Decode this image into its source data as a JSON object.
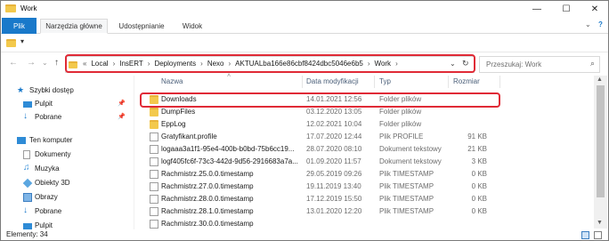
{
  "window": {
    "title": "Work",
    "minimize": "—",
    "maximize": "☐",
    "close": "✕"
  },
  "ribbon": {
    "tabs": [
      "Plik",
      "Narzędzia główne",
      "Udostępnianie",
      "Widok"
    ],
    "active_tab": "Narzędzia główne",
    "toggle": "⌄",
    "help": "?"
  },
  "qat": {
    "dropdown": "▾"
  },
  "address": {
    "back": "←",
    "forward": "→",
    "recent": "⌄",
    "up": "↑",
    "overflow": "«",
    "crumbs": [
      "Local",
      "InsERT",
      "Deployments",
      "Nexo",
      "AKTUALba166e86cbf8424dbc5046e6b5",
      "Work"
    ],
    "separator": "›",
    "dropdown": "⌄",
    "refresh": "↻"
  },
  "search": {
    "placeholder": "Przeszukaj: Work",
    "icon": "⌕"
  },
  "nav": {
    "items": [
      {
        "label": "Szybki dostęp",
        "icon": "star-icon",
        "pinned": false
      },
      {
        "label": "Pulpit",
        "icon": "desktop-icon",
        "pinned": true
      },
      {
        "label": "Pobrane",
        "icon": "download-icon",
        "pinned": true
      },
      {
        "label": "Ten komputer",
        "icon": "computer-icon",
        "pinned": false
      },
      {
        "label": "Dokumenty",
        "icon": "documents-icon",
        "pinned": false
      },
      {
        "label": "Muzyka",
        "icon": "music-icon",
        "pinned": false
      },
      {
        "label": "Obiekty 3D",
        "icon": "cube-icon",
        "pinned": false
      },
      {
        "label": "Obrazy",
        "icon": "pictures-icon",
        "pinned": false
      },
      {
        "label": "Pobrane",
        "icon": "download-icon",
        "pinned": false
      },
      {
        "label": "Pulpit",
        "icon": "desktop-icon",
        "pinned": false
      }
    ]
  },
  "columns": {
    "name": "Nazwa",
    "modified": "Data modyfikacji",
    "type": "Typ",
    "size": "Rozmiar",
    "sort_arrow": "˄"
  },
  "files": [
    {
      "name": "Downloads",
      "modified": "14.01.2021 12:56",
      "type": "Folder plików",
      "size": "",
      "kind": "folder"
    },
    {
      "name": "DumpFiles",
      "modified": "03.12.2020 13:05",
      "type": "Folder plików",
      "size": "",
      "kind": "folder"
    },
    {
      "name": "EppLog",
      "modified": "12.02.2021 10:04",
      "type": "Folder plików",
      "size": "",
      "kind": "folder"
    },
    {
      "name": "Gratyfikant.profile",
      "modified": "17.07.2020 12:44",
      "type": "Plik PROFILE",
      "size": "91 KB",
      "kind": "file"
    },
    {
      "name": "logaaa3a1f1-95e4-400b-b0bd-75b6cc19...",
      "modified": "28.07.2020 08:10",
      "type": "Dokument tekstowy",
      "size": "21 KB",
      "kind": "file"
    },
    {
      "name": "logf405fc6f-73c3-442d-9d56-2916683a7a...",
      "modified": "01.09.2020 11:57",
      "type": "Dokument tekstowy",
      "size": "3 KB",
      "kind": "file"
    },
    {
      "name": "Rachmistrz.25.0.0.timestamp",
      "modified": "29.05.2019 09:26",
      "type": "Plik TIMESTAMP",
      "size": "0 KB",
      "kind": "file"
    },
    {
      "name": "Rachmistrz.27.0.0.timestamp",
      "modified": "19.11.2019 13:40",
      "type": "Plik TIMESTAMP",
      "size": "0 KB",
      "kind": "file"
    },
    {
      "name": "Rachmistrz.28.0.0.timestamp",
      "modified": "17.12.2019 15:50",
      "type": "Plik TIMESTAMP",
      "size": "0 KB",
      "kind": "file"
    },
    {
      "name": "Rachmistrz.28.1.0.timestamp",
      "modified": "13.01.2020 12:20",
      "type": "Plik TIMESTAMP",
      "size": "0 KB",
      "kind": "file"
    },
    {
      "name": "Rachmistrz.30.0.0.timestamp",
      "modified": "",
      "type": "",
      "size": "",
      "kind": "file"
    }
  ],
  "status": {
    "count": "Elementy: 34"
  },
  "colors": {
    "accent": "#1979ca",
    "highlight": "#e02a36",
    "folder": "#f3c94c"
  }
}
